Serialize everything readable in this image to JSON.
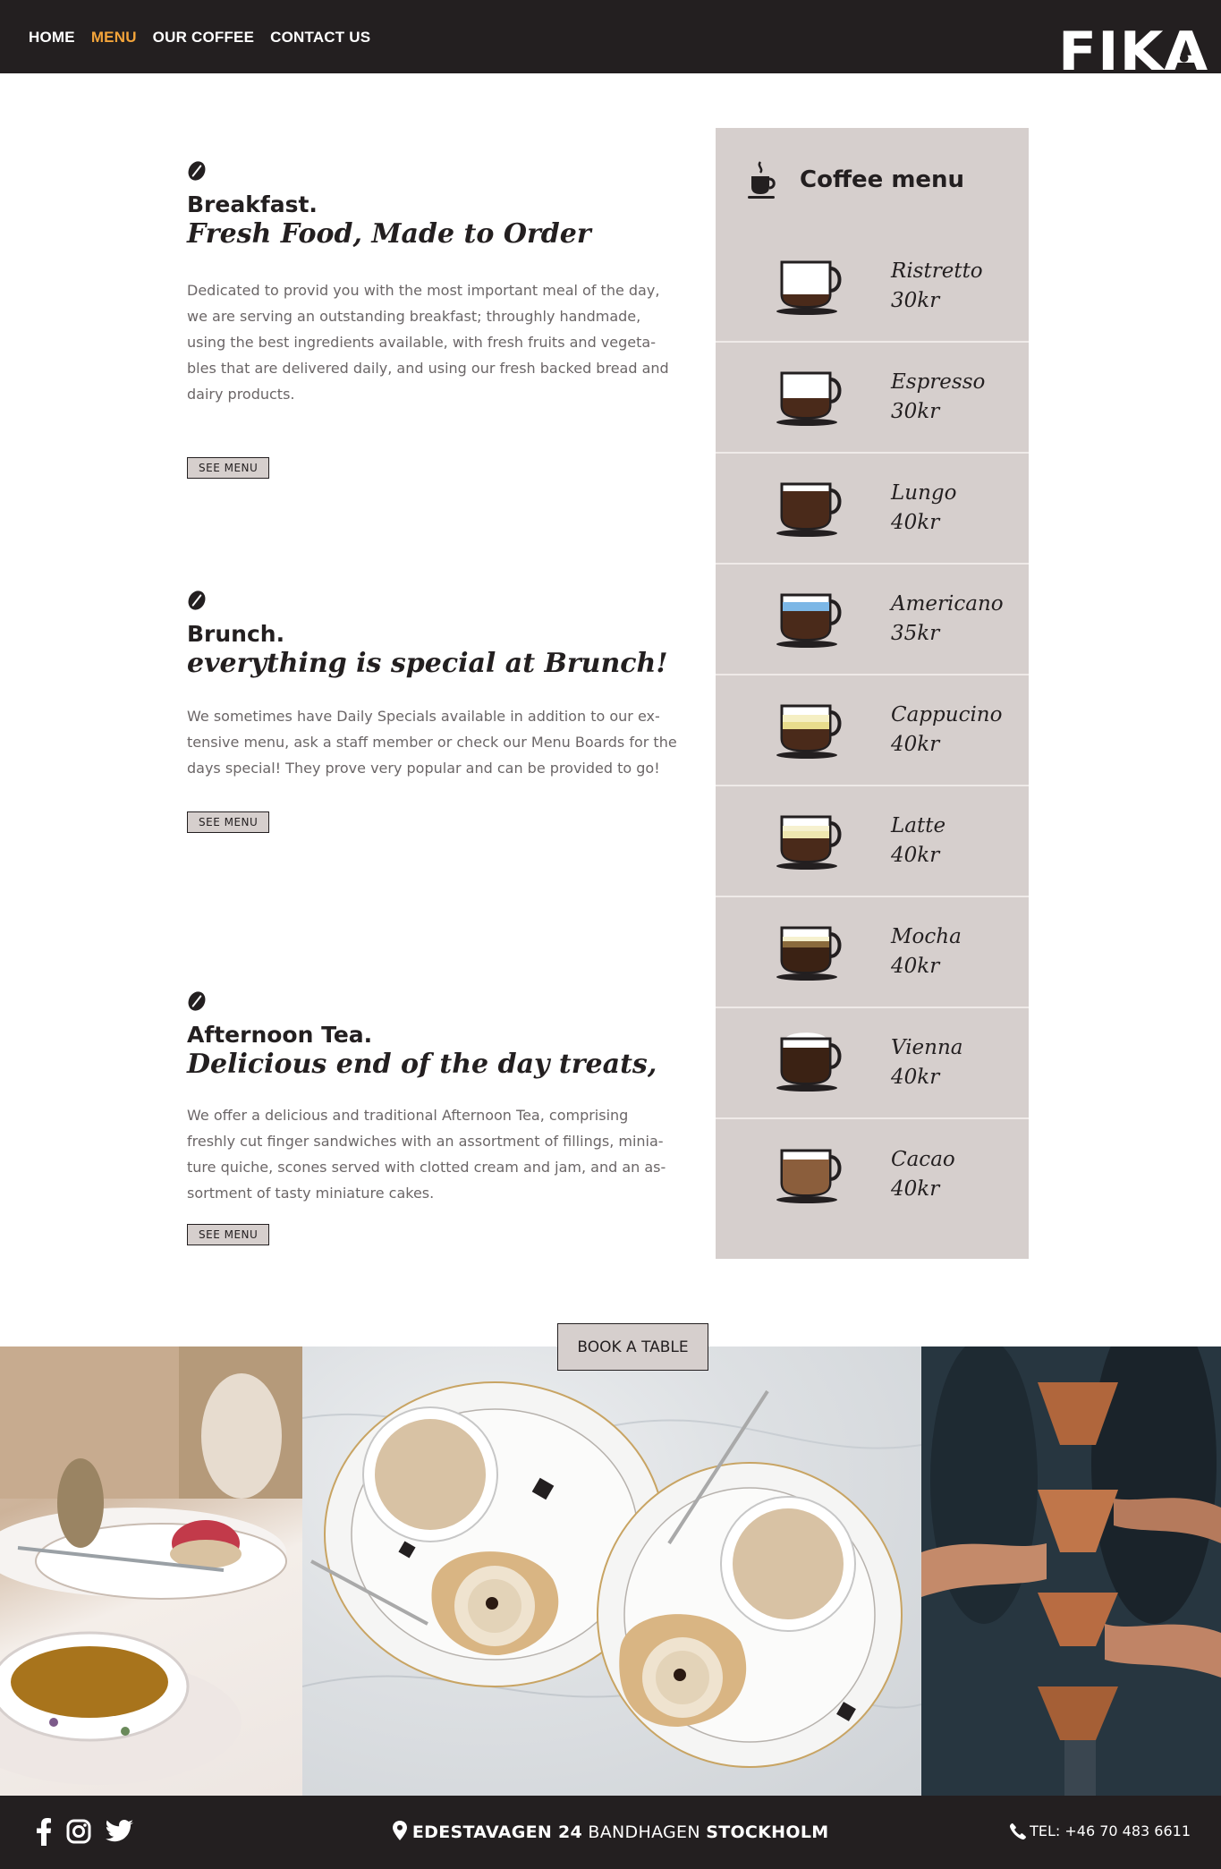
{
  "nav": {
    "items": [
      {
        "label": "HOME",
        "active": false
      },
      {
        "label": "MENU",
        "active": true
      },
      {
        "label": "OUR COFFEE",
        "active": false
      },
      {
        "label": "CONTACT US",
        "active": false
      }
    ],
    "logo": "FIKA"
  },
  "sections": [
    {
      "title": "Breakfast.",
      "subtitle": "Fresh Food, Made to Order",
      "body": [
        "Dedicated to provid you with the most important meal of the day,",
        "we are serving an outstanding breakfast; throughly handmade,",
        "using the best ingredients available, with fresh fruits and vegeta-",
        "bles that are delivered daily, and using our fresh backed bread and",
        "dairy products."
      ],
      "button": "SEE MENU"
    },
    {
      "title": "Brunch.",
      "subtitle": "everything is special at Brunch!",
      "body": [
        "We sometimes have Daily Specials available in addition to our ex-",
        "tensive menu, ask a staff member or check our Menu Boards for the",
        "days special! They prove very popular and can be provided to go!"
      ],
      "button": "SEE MENU"
    },
    {
      "title": "Afternoon Tea.",
      "subtitle": "Delicious end of the day treats,",
      "body": [
        "We offer a delicious and traditional Afternoon Tea, comprising",
        "freshly cut finger sandwiches with an assortment of fillings, minia-",
        "ture quiche, scones served with clotted cream and jam, and an as-",
        "sortment of tasty miniature cakes."
      ],
      "button": "SEE MENU"
    }
  ],
  "coffee_menu": {
    "title": "Coffee menu",
    "items": [
      {
        "name": "Ristretto",
        "price": "30kr"
      },
      {
        "name": "Espresso",
        "price": "30kr"
      },
      {
        "name": "Lungo",
        "price": "40kr"
      },
      {
        "name": "Americano",
        "price": "35kr"
      },
      {
        "name": "Cappucino",
        "price": "40kr"
      },
      {
        "name": "Latte",
        "price": "40kr"
      },
      {
        "name": "Mocha",
        "price": "40kr"
      },
      {
        "name": "Vienna",
        "price": "40kr"
      },
      {
        "name": "Cacao",
        "price": "40kr"
      }
    ]
  },
  "book_button": "BOOK A TABLE",
  "footer": {
    "social": [
      "facebook-icon",
      "instagram-icon",
      "twitter-icon"
    ],
    "address_street": "EDESTAVAGEN 24",
    "address_area": "BANDHAGEN",
    "address_city": "STOCKHOLM",
    "phone": "TEL: +46 70 483 6611"
  },
  "colors": {
    "dark": "#231f20",
    "accent": "#f3a43a",
    "panel": "#d6cfcd",
    "body_text": "#6b6667"
  }
}
